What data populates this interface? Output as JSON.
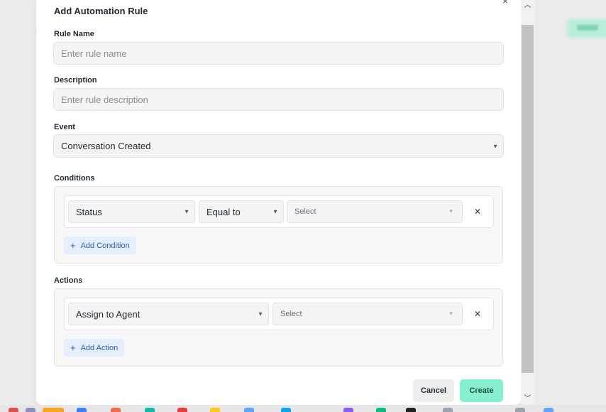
{
  "modal": {
    "title": "Add Automation Rule",
    "close_label": "×"
  },
  "rule_name": {
    "label": "Rule Name",
    "placeholder": "Enter rule name",
    "value": ""
  },
  "description": {
    "label": "Description",
    "placeholder": "Enter rule description",
    "value": ""
  },
  "event": {
    "label": "Event",
    "selected": "Conversation Created"
  },
  "conditions": {
    "label": "Conditions",
    "rows": [
      {
        "attribute": "Status",
        "operator": "Equal to",
        "value_placeholder": "Select"
      }
    ],
    "add_label": "Add Condition"
  },
  "actions": {
    "label": "Actions",
    "rows": [
      {
        "action": "Assign to Agent",
        "value_placeholder": "Select"
      }
    ],
    "add_label": "Add Action"
  },
  "footer": {
    "cancel_label": "Cancel",
    "create_label": "Create"
  },
  "icons": {
    "close": "close-icon",
    "caret": "chevron-down-icon",
    "plus": "plus-icon",
    "remove": "remove-icon"
  },
  "colors": {
    "create_button": "#86efcf",
    "add_button_bg": "#e5effb",
    "add_button_text": "#2563b4"
  }
}
